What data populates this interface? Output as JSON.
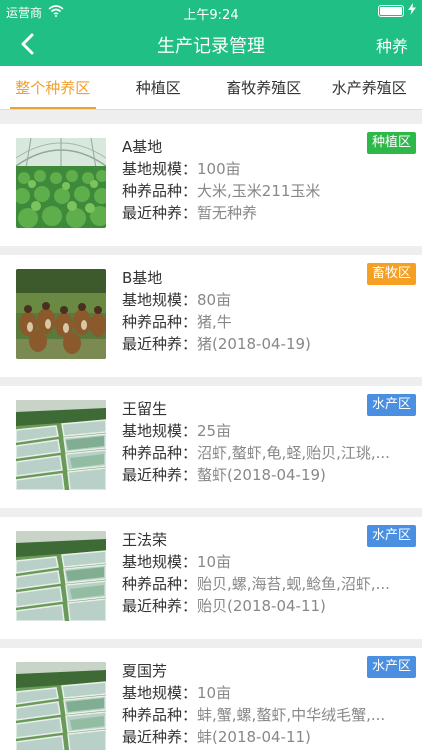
{
  "status": {
    "carrier": "运营商",
    "time": "上午9:24"
  },
  "nav": {
    "title": "生产记录管理",
    "action": "种养"
  },
  "tabs": [
    {
      "label": "整个种养区",
      "active": true
    },
    {
      "label": "种植区",
      "active": false
    },
    {
      "label": "畜牧养殖区",
      "active": false
    },
    {
      "label": "水产养殖区",
      "active": false
    }
  ],
  "labels": {
    "scale": "基地规模：",
    "varieties": "种养品种：",
    "recent": "最近种养："
  },
  "cards": [
    {
      "name": "A基地",
      "scale": "100亩",
      "varieties": "大米,玉米211玉米",
      "recent": "暂无种养",
      "badge": "种植区",
      "badge_color": "#2fb84a",
      "image": "greenhouse"
    },
    {
      "name": "B基地",
      "scale": "80亩",
      "varieties": "猪,牛",
      "recent": "猪(2018-04-19)",
      "badge": "畜牧区",
      "badge_color": "#f5a023",
      "image": "ducks"
    },
    {
      "name": "王留生",
      "scale": "25亩",
      "varieties": "沼虾,螯虾,龟,蛏,贻贝,江珧,...",
      "recent": "螯虾(2018-04-19)",
      "badge": "水产区",
      "badge_color": "#4a8fe0",
      "image": "ponds"
    },
    {
      "name": "王法荣",
      "scale": "10亩",
      "varieties": "贻贝,螺,海苔,蚬,鲶鱼,沼虾,...",
      "recent": "贻贝(2018-04-11)",
      "badge": "水产区",
      "badge_color": "#4a8fe0",
      "image": "ponds"
    },
    {
      "name": "夏国芳",
      "scale": "10亩",
      "varieties": "蚌,蟹,螺,螯虾,中华绒毛蟹,...",
      "recent": "蚌(2018-04-11)",
      "badge": "水产区",
      "badge_color": "#4a8fe0",
      "image": "ponds"
    }
  ]
}
